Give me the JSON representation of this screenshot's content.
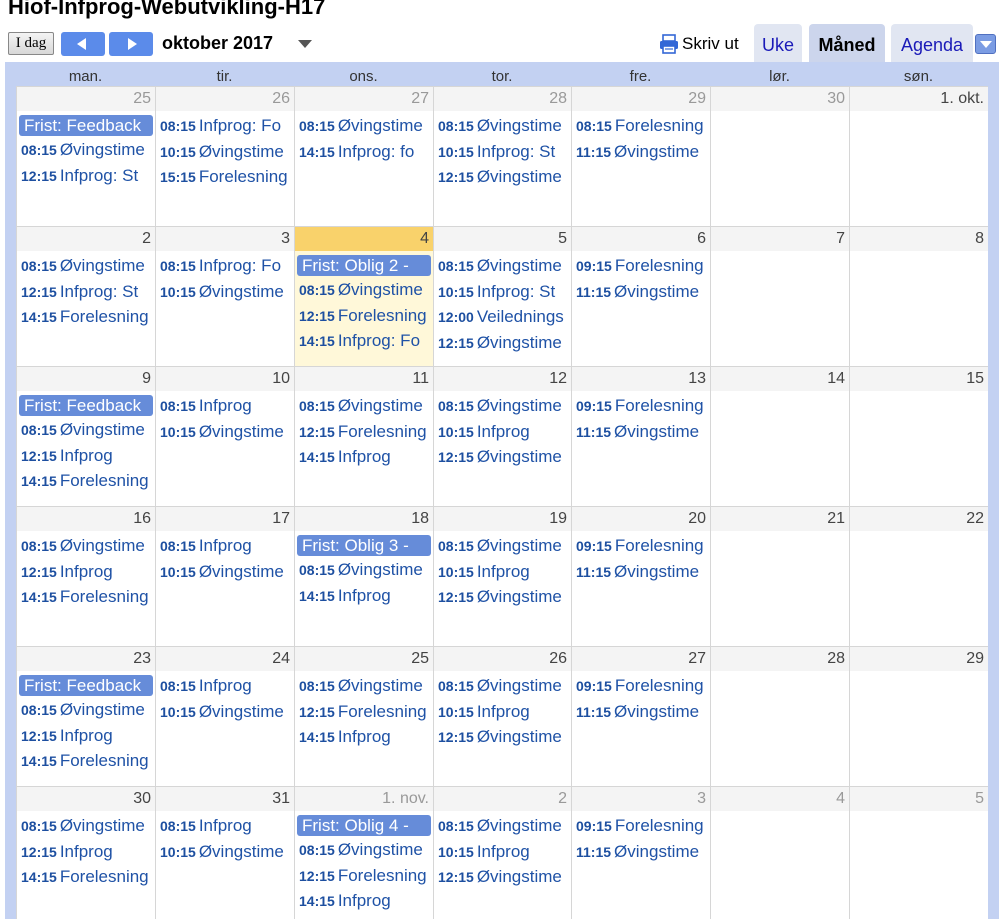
{
  "header": {
    "calendar_title": "Hiof-Infprog-Webutvikling-H17",
    "today_label": "I dag",
    "prev_label": "",
    "next_label": "",
    "date_range": "oktober 2017",
    "print_label": "Skriv ut",
    "tabs": [
      {
        "label": "Uke",
        "active": false
      },
      {
        "label": "Måned",
        "active": true
      },
      {
        "label": "Agenda",
        "active": false
      }
    ]
  },
  "colors": {
    "accent": "#5b8bea",
    "allday_event": "#668cd9",
    "event_text": "#1f52a6",
    "grid_bg": "#c3d1f2",
    "today_bar": "#f9d26b",
    "today_bg": "#fff8d9"
  },
  "days_of_week": [
    "man.",
    "tir.",
    "ons.",
    "tor.",
    "fre.",
    "lør.",
    "søn."
  ],
  "weeks": [
    [
      {
        "day": "25",
        "other": true,
        "events": [
          {
            "allday": true,
            "title": "Frist: Feedback"
          },
          {
            "time": "08:15",
            "title": "Øvingstime"
          },
          {
            "time": "12:15",
            "title": "Infprog: St"
          }
        ]
      },
      {
        "day": "26",
        "other": true,
        "events": [
          {
            "time": "08:15",
            "title": "Infprog: Fo"
          },
          {
            "time": "10:15",
            "title": "Øvingstime"
          },
          {
            "time": "15:15",
            "title": "Forelesning"
          }
        ]
      },
      {
        "day": "27",
        "other": true,
        "events": [
          {
            "time": "08:15",
            "title": "Øvingstime"
          },
          {
            "time": "14:15",
            "title": "Infprog: fo"
          }
        ]
      },
      {
        "day": "28",
        "other": true,
        "events": [
          {
            "time": "08:15",
            "title": "Øvingstime"
          },
          {
            "time": "10:15",
            "title": "Infprog: St"
          },
          {
            "time": "12:15",
            "title": "Øvingstime"
          }
        ]
      },
      {
        "day": "29",
        "other": true,
        "events": [
          {
            "time": "08:15",
            "title": "Forelesning"
          },
          {
            "time": "11:15",
            "title": "Øvingstime"
          }
        ]
      },
      {
        "day": "30",
        "other": true,
        "events": []
      },
      {
        "day": "1. okt.",
        "other": false,
        "events": []
      }
    ],
    [
      {
        "day": "2",
        "other": false,
        "events": [
          {
            "time": "08:15",
            "title": "Øvingstime"
          },
          {
            "time": "12:15",
            "title": "Infprog: St"
          },
          {
            "time": "14:15",
            "title": "Forelesning"
          }
        ]
      },
      {
        "day": "3",
        "other": false,
        "events": [
          {
            "time": "08:15",
            "title": "Infprog: Fo"
          },
          {
            "time": "10:15",
            "title": "Øvingstime"
          }
        ]
      },
      {
        "day": "4",
        "other": false,
        "today": true,
        "events": [
          {
            "allday": true,
            "title": "Frist: Oblig 2 - "
          },
          {
            "time": "08:15",
            "title": "Øvingstime"
          },
          {
            "time": "12:15",
            "title": "Forelesning"
          },
          {
            "time": "14:15",
            "title": "Infprog: Fo"
          }
        ]
      },
      {
        "day": "5",
        "other": false,
        "events": [
          {
            "time": "08:15",
            "title": "Øvingstime"
          },
          {
            "time": "10:15",
            "title": "Infprog: St"
          },
          {
            "time": "12:00",
            "title": "Veilednings"
          },
          {
            "time": "12:15",
            "title": "Øvingstime"
          }
        ]
      },
      {
        "day": "6",
        "other": false,
        "events": [
          {
            "time": "09:15",
            "title": "Forelesning"
          },
          {
            "time": "11:15",
            "title": "Øvingstime"
          }
        ]
      },
      {
        "day": "7",
        "other": false,
        "events": []
      },
      {
        "day": "8",
        "other": false,
        "events": []
      }
    ],
    [
      {
        "day": "9",
        "other": false,
        "events": [
          {
            "allday": true,
            "title": "Frist: Feedback"
          },
          {
            "time": "08:15",
            "title": "Øvingstime"
          },
          {
            "time": "12:15",
            "title": "Infprog"
          },
          {
            "time": "14:15",
            "title": "Forelesning"
          }
        ]
      },
      {
        "day": "10",
        "other": false,
        "events": [
          {
            "time": "08:15",
            "title": "Infprog"
          },
          {
            "time": "10:15",
            "title": "Øvingstime"
          }
        ]
      },
      {
        "day": "11",
        "other": false,
        "events": [
          {
            "time": "08:15",
            "title": "Øvingstime"
          },
          {
            "time": "12:15",
            "title": "Forelesning"
          },
          {
            "time": "14:15",
            "title": "Infprog"
          }
        ]
      },
      {
        "day": "12",
        "other": false,
        "events": [
          {
            "time": "08:15",
            "title": "Øvingstime"
          },
          {
            "time": "10:15",
            "title": "Infprog"
          },
          {
            "time": "12:15",
            "title": "Øvingstime"
          }
        ]
      },
      {
        "day": "13",
        "other": false,
        "events": [
          {
            "time": "09:15",
            "title": "Forelesning"
          },
          {
            "time": "11:15",
            "title": "Øvingstime"
          }
        ]
      },
      {
        "day": "14",
        "other": false,
        "events": []
      },
      {
        "day": "15",
        "other": false,
        "events": []
      }
    ],
    [
      {
        "day": "16",
        "other": false,
        "events": [
          {
            "time": "08:15",
            "title": "Øvingstime"
          },
          {
            "time": "12:15",
            "title": "Infprog"
          },
          {
            "time": "14:15",
            "title": "Forelesning"
          }
        ]
      },
      {
        "day": "17",
        "other": false,
        "events": [
          {
            "time": "08:15",
            "title": "Infprog"
          },
          {
            "time": "10:15",
            "title": "Øvingstime"
          }
        ]
      },
      {
        "day": "18",
        "other": false,
        "events": [
          {
            "allday": true,
            "title": "Frist: Oblig 3 - "
          },
          {
            "time": "08:15",
            "title": "Øvingstime"
          },
          {
            "time": "14:15",
            "title": "Infprog"
          }
        ]
      },
      {
        "day": "19",
        "other": false,
        "events": [
          {
            "time": "08:15",
            "title": "Øvingstime"
          },
          {
            "time": "10:15",
            "title": "Infprog"
          },
          {
            "time": "12:15",
            "title": "Øvingstime"
          }
        ]
      },
      {
        "day": "20",
        "other": false,
        "events": [
          {
            "time": "09:15",
            "title": "Forelesning"
          },
          {
            "time": "11:15",
            "title": "Øvingstime"
          }
        ]
      },
      {
        "day": "21",
        "other": false,
        "events": []
      },
      {
        "day": "22",
        "other": false,
        "events": []
      }
    ],
    [
      {
        "day": "23",
        "other": false,
        "events": [
          {
            "allday": true,
            "title": "Frist: Feedback"
          },
          {
            "time": "08:15",
            "title": "Øvingstime"
          },
          {
            "time": "12:15",
            "title": "Infprog"
          },
          {
            "time": "14:15",
            "title": "Forelesning"
          }
        ]
      },
      {
        "day": "24",
        "other": false,
        "events": [
          {
            "time": "08:15",
            "title": "Infprog"
          },
          {
            "time": "10:15",
            "title": "Øvingstime"
          }
        ]
      },
      {
        "day": "25",
        "other": false,
        "events": [
          {
            "time": "08:15",
            "title": "Øvingstime"
          },
          {
            "time": "12:15",
            "title": "Forelesning"
          },
          {
            "time": "14:15",
            "title": "Infprog"
          }
        ]
      },
      {
        "day": "26",
        "other": false,
        "events": [
          {
            "time": "08:15",
            "title": "Øvingstime"
          },
          {
            "time": "10:15",
            "title": "Infprog"
          },
          {
            "time": "12:15",
            "title": "Øvingstime"
          }
        ]
      },
      {
        "day": "27",
        "other": false,
        "events": [
          {
            "time": "09:15",
            "title": "Forelesning"
          },
          {
            "time": "11:15",
            "title": "Øvingstime"
          }
        ]
      },
      {
        "day": "28",
        "other": false,
        "events": []
      },
      {
        "day": "29",
        "other": false,
        "events": []
      }
    ],
    [
      {
        "day": "30",
        "other": false,
        "events": [
          {
            "time": "08:15",
            "title": "Øvingstime"
          },
          {
            "time": "12:15",
            "title": "Infprog"
          },
          {
            "time": "14:15",
            "title": "Forelesning"
          }
        ]
      },
      {
        "day": "31",
        "other": false,
        "events": [
          {
            "time": "08:15",
            "title": "Infprog"
          },
          {
            "time": "10:15",
            "title": "Øvingstime"
          }
        ]
      },
      {
        "day": "1. nov.",
        "other": true,
        "events": [
          {
            "allday": true,
            "title": "Frist: Oblig 4 - "
          },
          {
            "time": "08:15",
            "title": "Øvingstime"
          },
          {
            "time": "12:15",
            "title": "Forelesning"
          },
          {
            "time": "14:15",
            "title": "Infprog"
          }
        ]
      },
      {
        "day": "2",
        "other": true,
        "events": [
          {
            "time": "08:15",
            "title": "Øvingstime"
          },
          {
            "time": "10:15",
            "title": "Infprog"
          },
          {
            "time": "12:15",
            "title": "Øvingstime"
          }
        ]
      },
      {
        "day": "3",
        "other": true,
        "events": [
          {
            "time": "09:15",
            "title": "Forelesning"
          },
          {
            "time": "11:15",
            "title": "Øvingstime"
          }
        ]
      },
      {
        "day": "4",
        "other": true,
        "events": []
      },
      {
        "day": "5",
        "other": true,
        "events": []
      }
    ]
  ]
}
